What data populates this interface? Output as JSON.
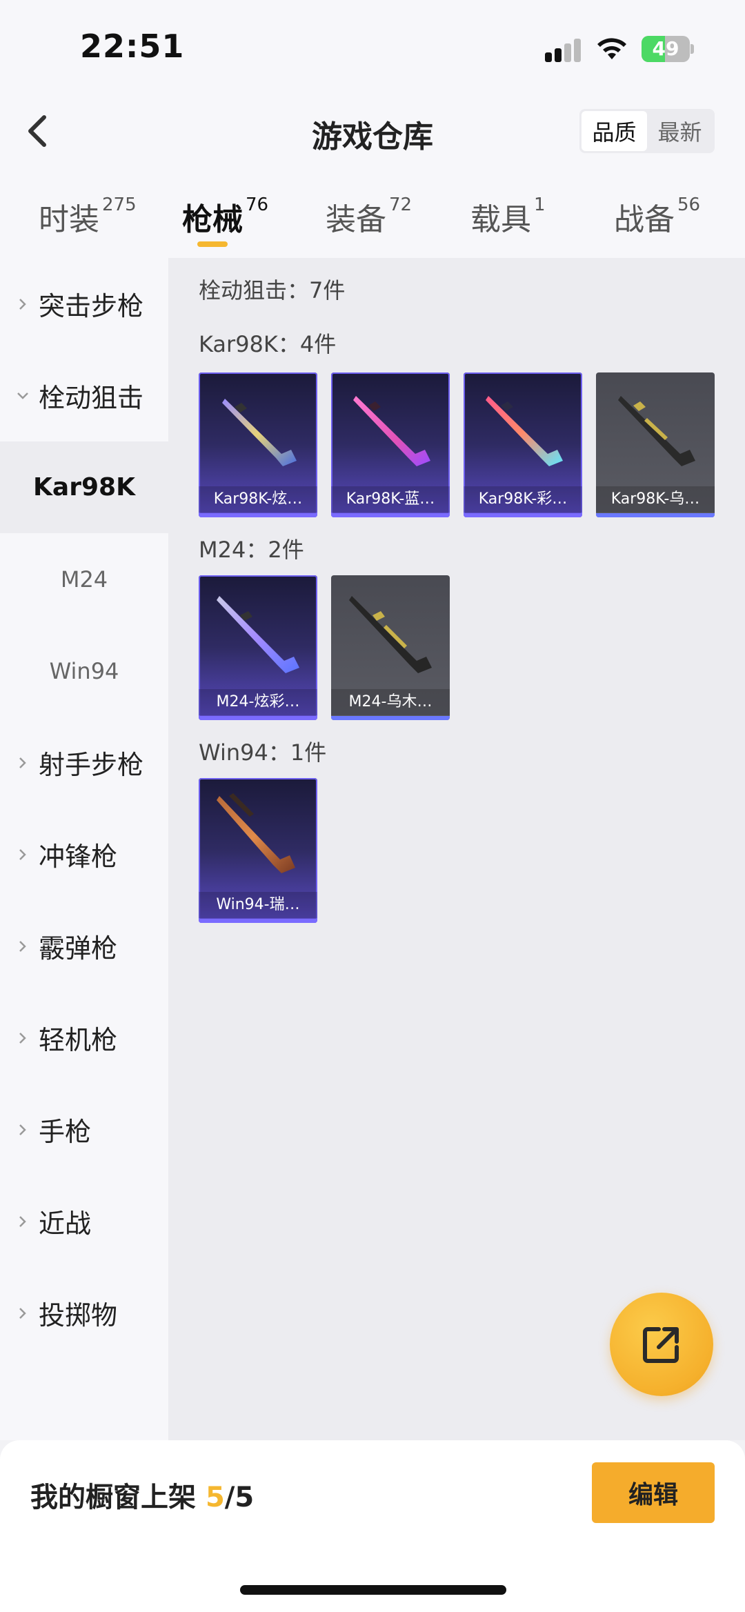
{
  "status": {
    "time": "22:51",
    "battery": "49",
    "battery_level": 0.49
  },
  "header": {
    "title": "游戏仓库",
    "sort_options": [
      "品质",
      "最新"
    ],
    "active_sort": 0
  },
  "tabs": [
    {
      "label": "时装",
      "count": "275"
    },
    {
      "label": "枪械",
      "count": "76"
    },
    {
      "label": "装备",
      "count": "72"
    },
    {
      "label": "载具",
      "count": "1"
    },
    {
      "label": "战备",
      "count": "56"
    }
  ],
  "active_tab": 1,
  "sidebar": {
    "categories": [
      {
        "label": "突击步枪",
        "expanded": false
      },
      {
        "label": "栓动狙击",
        "expanded": true
      },
      {
        "label": "射手步枪",
        "expanded": false
      },
      {
        "label": "冲锋枪",
        "expanded": false
      },
      {
        "label": "霰弹枪",
        "expanded": false
      },
      {
        "label": "轻机枪",
        "expanded": false
      },
      {
        "label": "手枪",
        "expanded": false
      },
      {
        "label": "近战",
        "expanded": false
      },
      {
        "label": "投掷物",
        "expanded": false
      }
    ],
    "subcategories": [
      "Kar98K",
      "M24",
      "Win94"
    ],
    "active_sub": 0
  },
  "main": {
    "summary": "栓动狙击：7件",
    "groups": [
      {
        "title": "Kar98K：4件",
        "items": [
          {
            "name": "Kar98K-炫…",
            "rarity": "purple",
            "skin": "colorful"
          },
          {
            "name": "Kar98K-蓝…",
            "rarity": "purple",
            "skin": "pink"
          },
          {
            "name": "Kar98K-彩…",
            "rarity": "purple",
            "skin": "rainbow"
          },
          {
            "name": "Kar98K-乌…",
            "rarity": "gray",
            "skin": "ebony"
          }
        ]
      },
      {
        "title": "M24：2件",
        "items": [
          {
            "name": "M24-炫彩…",
            "rarity": "purple",
            "skin": "colorful"
          },
          {
            "name": "M24-乌木…",
            "rarity": "gray",
            "skin": "ebony"
          }
        ]
      },
      {
        "title": "Win94：1件",
        "items": [
          {
            "name": "Win94-瑞…",
            "rarity": "purple",
            "skin": "copper"
          }
        ]
      }
    ]
  },
  "bottom": {
    "shelf_label": "我的橱窗上架",
    "shelf_current": "5",
    "shelf_total": "/5",
    "edit_label": "编辑"
  },
  "colors": {
    "accent": "#f5b730",
    "purple_bar": "#7a6bff"
  },
  "icons": {
    "back": "back-arrow-icon",
    "share": "share-external-icon",
    "chevron": "chevron-right-icon"
  }
}
